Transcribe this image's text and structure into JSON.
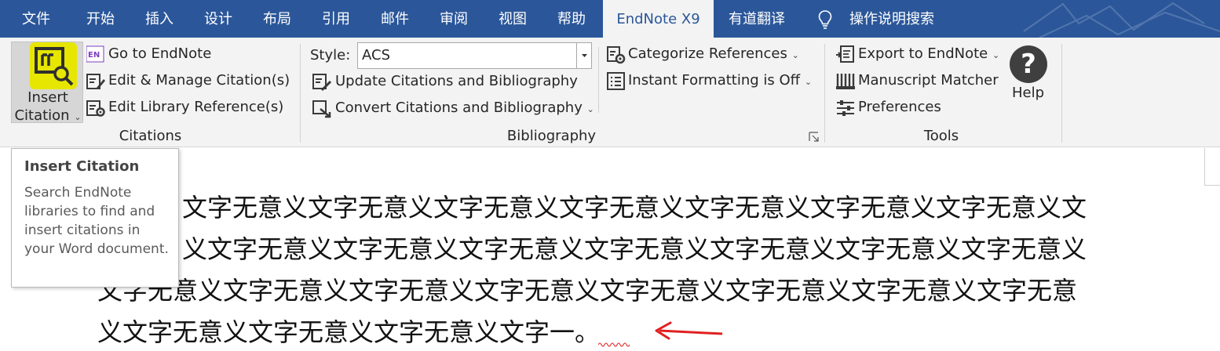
{
  "menu_tabs": [
    {
      "label": "文件"
    },
    {
      "label": "开始"
    },
    {
      "label": "插入"
    },
    {
      "label": "设计"
    },
    {
      "label": "布局"
    },
    {
      "label": "引用"
    },
    {
      "label": "邮件"
    },
    {
      "label": "审阅"
    },
    {
      "label": "视图"
    },
    {
      "label": "帮助"
    },
    {
      "label": "EndNote X9",
      "active": true
    },
    {
      "label": "有道翻译"
    }
  ],
  "tell_me": {
    "label": "操作说明搜索",
    "icon": "lightbulb-icon"
  },
  "ribbon": {
    "citations": {
      "group_label": "Citations",
      "insert_citation": {
        "line1": "Insert",
        "line2": "Citation",
        "icon": "insert-citation-icon"
      },
      "go_to_endnote": {
        "label": "Go to EndNote",
        "icon": "endnote-logo-icon",
        "icon_text": "EN"
      },
      "edit_manage": {
        "label": "Edit & Manage Citation(s)",
        "icon": "edit-citation-icon"
      },
      "edit_library": {
        "label": "Edit Library Reference(s)",
        "icon": "edit-library-icon"
      }
    },
    "bibliography": {
      "group_label": "Bibliography",
      "style_label": "Style:",
      "style_value": "ACS",
      "update": {
        "label": "Update Citations and Bibliography",
        "icon": "update-icon"
      },
      "convert": {
        "label": "Convert Citations and Bibliography",
        "icon": "convert-icon"
      },
      "categorize": {
        "label": "Categorize References",
        "icon": "categorize-icon"
      },
      "instant": {
        "label": "Instant Formatting is Off",
        "icon": "instant-formatting-icon"
      }
    },
    "tools": {
      "group_label": "Tools",
      "export": {
        "label": "Export to EndNote",
        "icon": "export-icon"
      },
      "manuscript": {
        "label": "Manuscript Matcher",
        "icon": "manuscript-matcher-icon"
      },
      "preferences": {
        "label": "Preferences",
        "icon": "preferences-icon"
      },
      "help": {
        "label": "Help",
        "glyph": "?",
        "icon": "help-icon"
      }
    }
  },
  "tooltip": {
    "title": "Insert Citation",
    "body": "Search EndNote libraries to find and insert citations in your Word document."
  },
  "document": {
    "lines": [
      "文字无意义文字无意义文字无意义文字无意义文字无意义文字无意义文字无意义文",
      "义文字无意义文字无意义文字无意义文字无意义文字无意义文字无意义文字无意义",
      "文字无意义文字无意义文字无意义文字无意义文字无意义文字无意义文字无意义文字无意",
      "义文字无意义文字无意义文字无意义文字一。"
    ]
  },
  "colors": {
    "tab_bar": "#2b579a",
    "ribbon": "#f3f3f3",
    "highlight": "#e6e600",
    "arrow": "#e02020"
  }
}
